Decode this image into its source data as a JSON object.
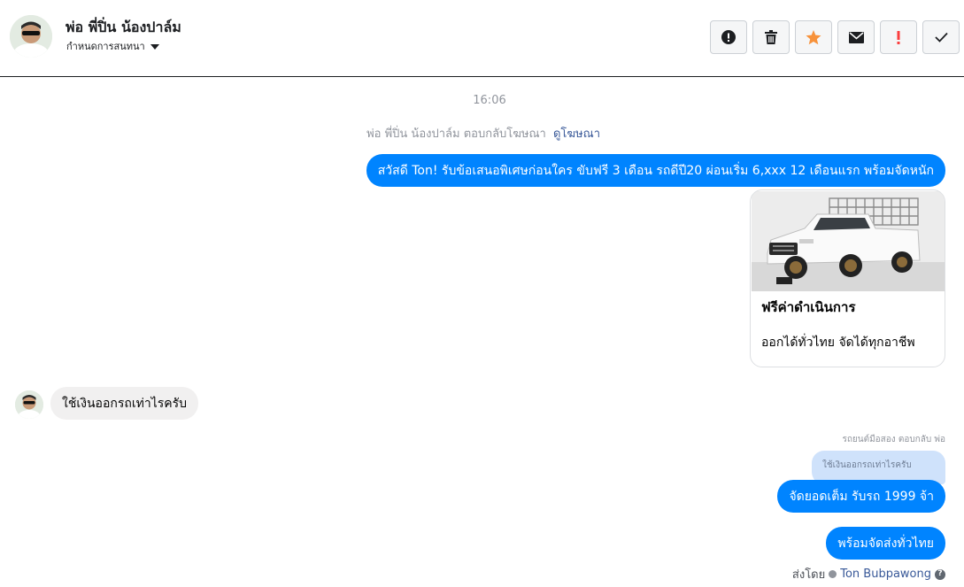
{
  "header": {
    "contact_name": "พ่อ พี่ปิ่น น้องปาล์ม",
    "assign_label": "กำหนดการสนทนา",
    "actions": [
      {
        "icon": "alert-circle-icon",
        "color": "#1c1e21"
      },
      {
        "icon": "trash-icon",
        "color": "#1c1e21"
      },
      {
        "icon": "star-icon",
        "color": "#f7923b"
      },
      {
        "icon": "envelope-icon",
        "color": "#1c1e21"
      },
      {
        "icon": "exclamation-icon",
        "color": "#fa3e3e"
      },
      {
        "icon": "checkmark-icon",
        "color": "#1c1e21"
      }
    ]
  },
  "conversation": {
    "timestamp": "16:06",
    "ad_reply": {
      "text": "พ่อ พี่ปิ่น น้องปาล์ม ตอบกลับโฆษณา",
      "link": "ดูโฆษณา"
    },
    "messages": {
      "promo": "สวัสดี Ton! รับข้อเสนอพิเศษก่อนใคร ขับฟรี 3 เดือน รถดีปี20 ผ่อนเริ่ม 6,xxx 12 เดือนแรก  พร้อมจัดหนัก",
      "card_title": "ฟรีค่าดำเนินการ",
      "card_subtitle": "ออกได้ทั่วไทย จัดได้ทุกอาชีพ",
      "incoming": "ใช้เงินออกรถเท่าไรครับ",
      "reply_note": "รถยนต์มือสอง ตอบกลับ พ่อ",
      "quoted": "ใช้เงินออกรถเท่าไรครับ",
      "reply_1": "จัดยอดเต็ม รับรถ 1999 จ้า",
      "reply_2": "พร้อมจัดส่งทั่วไทย"
    },
    "sent_by": {
      "label": "ส่งโดย",
      "name": "Ton Bubpawong"
    }
  },
  "colors": {
    "outgoing_bubble": "#0084ff",
    "incoming_bubble": "#f1f0f0",
    "link": "#385898"
  }
}
